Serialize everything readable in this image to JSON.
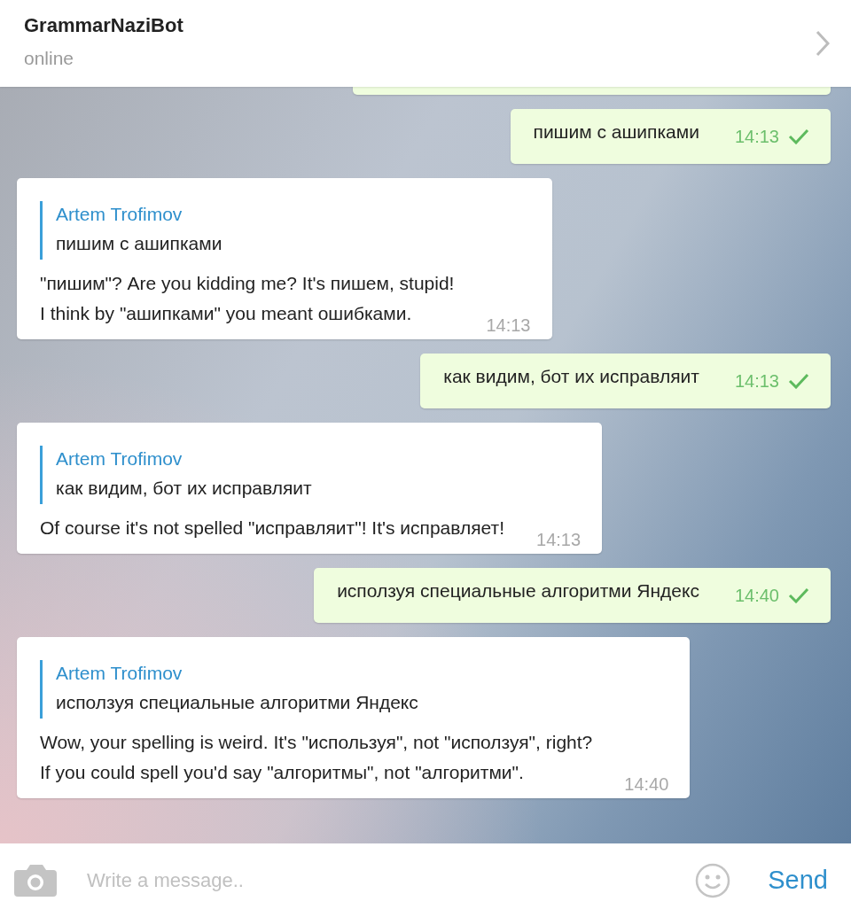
{
  "header": {
    "title": "GrammarNaziBot",
    "status": "online"
  },
  "messages": [
    {
      "kind": "clipped",
      "outgoing": true
    },
    {
      "kind": "text",
      "outgoing": true,
      "text": "пишим с ашипками",
      "time": "14:13",
      "read": true
    },
    {
      "kind": "reply",
      "outgoing": false,
      "reply_name": "Artem Trofimov",
      "reply_text": "пишим с ашипками",
      "text": "\"пишим\"? Are you kidding me? It's пишем, stupid!\nI think by \"ашипками\" you meant ошибками.",
      "time": "14:13"
    },
    {
      "kind": "text",
      "outgoing": true,
      "text": "как видим, бот их исправляит",
      "time": "14:13",
      "read": true
    },
    {
      "kind": "reply",
      "outgoing": false,
      "reply_name": "Artem Trofimov",
      "reply_text": "как видим, бот их исправляит",
      "text": "Of course it's not spelled \"исправляит\"! It's исправляет!",
      "time": "14:13"
    },
    {
      "kind": "text",
      "outgoing": true,
      "text": "исползуя специальные алгоритми Яндекс",
      "time": "14:40",
      "read": true
    },
    {
      "kind": "reply",
      "outgoing": false,
      "reply_name": "Artem Trofimov",
      "reply_text": "исползуя специальные алгоритми Яндекс",
      "text": "Wow, your spelling is weird. It's \"используя\", not \"исползуя\", right?\nIf you could spell you'd say \"алгоритмы\", not \"алгоритми\".",
      "time": "14:40"
    }
  ],
  "composer": {
    "placeholder": "Write a message..",
    "send": "Send"
  }
}
